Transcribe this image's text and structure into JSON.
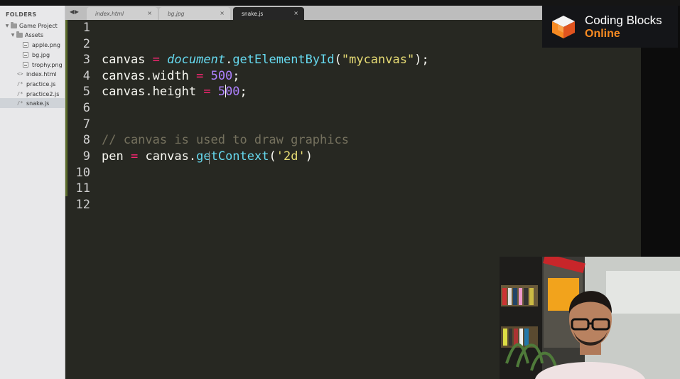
{
  "sidebar": {
    "header": "FOLDERS",
    "items": [
      {
        "label": "Game Project",
        "kind": "folder",
        "depth": 0,
        "expanded": true
      },
      {
        "label": "Assets",
        "kind": "folder",
        "depth": 1,
        "expanded": true
      },
      {
        "label": "apple.png",
        "kind": "image",
        "depth": 2
      },
      {
        "label": "bg.jpg",
        "kind": "image",
        "depth": 2
      },
      {
        "label": "trophy.png",
        "kind": "image",
        "depth": 2
      },
      {
        "label": "index.html",
        "kind": "code",
        "icon": "<>",
        "depth": 1
      },
      {
        "label": "practice.js",
        "kind": "code",
        "icon": "/*",
        "depth": 1
      },
      {
        "label": "practice2.js",
        "kind": "code",
        "icon": "/*",
        "depth": 1
      },
      {
        "label": "snake.js",
        "kind": "code",
        "icon": "/*",
        "depth": 1,
        "selected": true
      }
    ]
  },
  "tabs": [
    {
      "label": "index.html",
      "close": "×",
      "active": false
    },
    {
      "label": "bg.jpg",
      "close": "×",
      "active": false
    },
    {
      "label": "snake.js",
      "close": "×",
      "active": true
    }
  ],
  "tab_nav": "◀ ▶",
  "editor": {
    "line_numbers": [
      "1",
      "2",
      "3",
      "4",
      "5",
      "6",
      "7",
      "8",
      "9",
      "10",
      "11",
      "12"
    ],
    "lines": {
      "l3": {
        "v1": "canvas",
        "op": "=",
        "obj": "document",
        "dot": ".",
        "fn": "getElementById",
        "p1": "(",
        "str": "\"mycanvas\"",
        "p2": ");"
      },
      "l4": {
        "a": "canvas.width",
        "op": "=",
        "num": "500",
        "semi": ";"
      },
      "l5": {
        "a": "canvas.height",
        "op": "=",
        "num_a": "5",
        "num_b": "00",
        "semi": ";"
      },
      "l8": {
        "comment": "// canvas is used to draw graphics"
      },
      "l9": {
        "a": "pen",
        "op": "=",
        "obj": "canvas.",
        "fn": "getContext",
        "p1": "(",
        "str": "'2d'",
        "p2": ")"
      }
    }
  },
  "logo": {
    "line1": "Coding Blocks",
    "line2": "Online"
  },
  "colors": {
    "editor_bg": "#272822",
    "sidebar_bg": "#e8e8ea",
    "operator": "#f92672",
    "function": "#66d9ef",
    "string": "#e6db74",
    "number": "#ae81ff",
    "comment": "#75715e",
    "logo_accent": "#f68a22"
  }
}
